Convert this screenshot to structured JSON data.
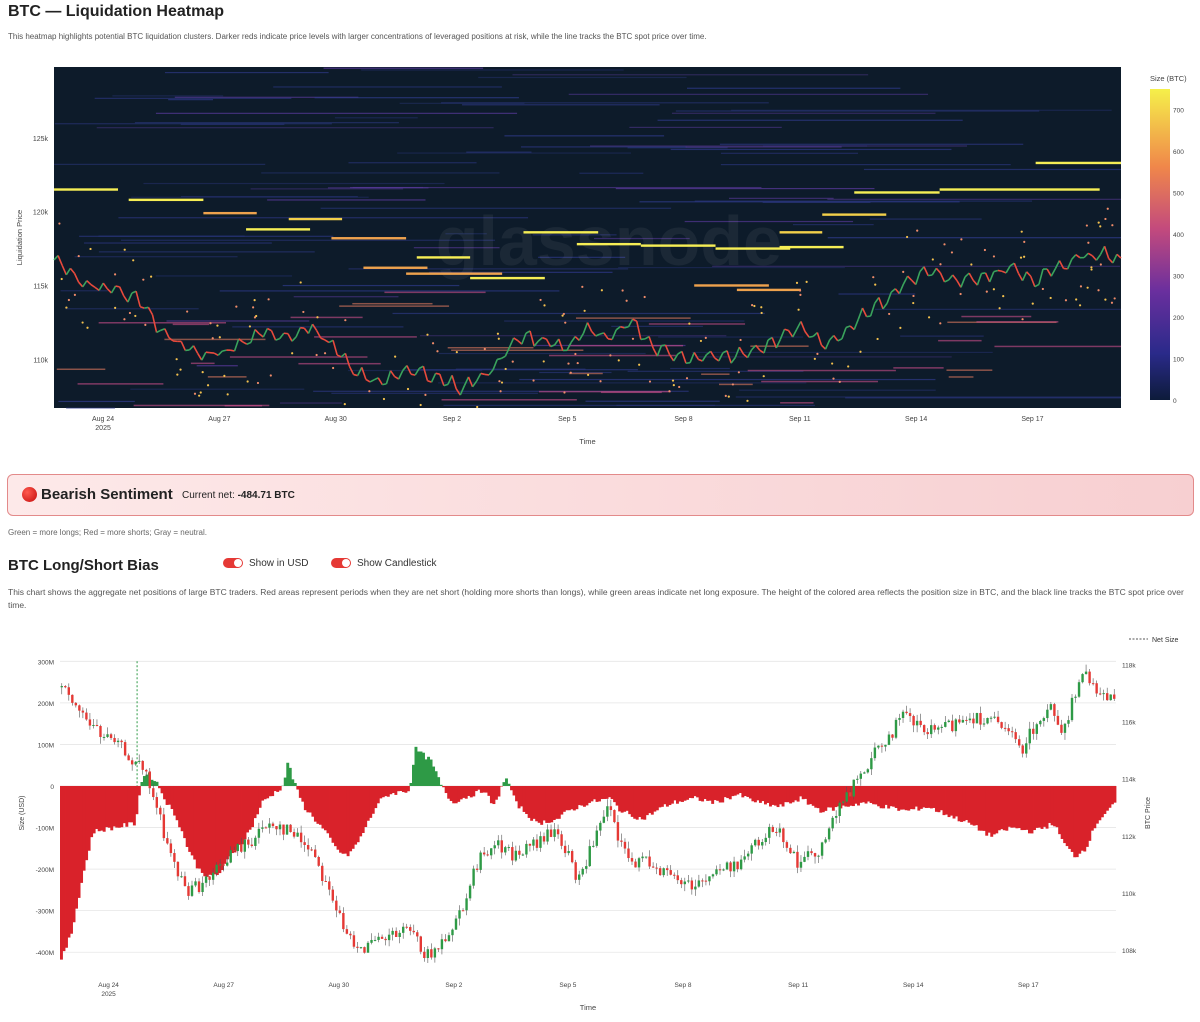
{
  "heatmap": {
    "title": "BTC — Liquidation Heatmap",
    "description": "This heatmap highlights potential BTC liquidation clusters. Darker reds indicate price levels with larger concentrations of leveraged positions at risk, while the line tracks the BTC spot price over time.",
    "watermark": "glassnode",
    "colors": {
      "background": "#0d1b2a",
      "low": "#3b3a9e",
      "mid": "#c94f8a",
      "high": "#f6e64a"
    }
  },
  "sentiment": {
    "label": "Bearish Sentiment",
    "net_label": "Current net:",
    "net_value": "-484.71 BTC",
    "color": "#d32f2f"
  },
  "legend_note": "Green = more longs; Red = more shorts; Gray = neutral.",
  "bias": {
    "title": "BTC Long/Short Bias",
    "toggle_usd": "Show in USD",
    "toggle_candles": "Show Candlestick",
    "description": "This chart shows the aggregate net positions of large BTC traders. Red areas represent periods when they are net short (holding more shorts than longs), while green areas indicate net long exposure. The height of the colored area reflects the position size in BTC, and the black line tracks the BTC spot price over time.",
    "colors": {
      "short": "#d9222a",
      "long": "#2e9a46",
      "candle_up": "#2e9a46",
      "candle_down": "#e53935"
    }
  },
  "chart_data": [
    {
      "type": "heatmap",
      "xlabel": "Time",
      "ylabel": "Liquidation Price",
      "x_ticks": [
        "Aug 24",
        "Aug 27",
        "Aug 30",
        "Sep 2",
        "Sep 5",
        "Sep 8",
        "Sep 11",
        "Sep 14",
        "Sep 17"
      ],
      "x_tick_sub": "2025",
      "y_ticks": [
        "125k",
        "120k",
        "115k",
        "110k"
      ],
      "ylim": [
        106700,
        129800
      ],
      "colorbar": {
        "label": "Size (BTC)",
        "ticks": [
          0,
          100,
          200,
          300,
          400,
          500,
          600,
          700
        ],
        "range": [
          0,
          750
        ]
      },
      "price_line": [
        [
          0,
          116800
        ],
        [
          0.02,
          115500
        ],
        [
          0.04,
          115000
        ],
        [
          0.06,
          114600
        ],
        [
          0.08,
          114100
        ],
        [
          0.1,
          112000
        ],
        [
          0.12,
          110800
        ],
        [
          0.14,
          110200
        ],
        [
          0.16,
          110500
        ],
        [
          0.18,
          111200
        ],
        [
          0.2,
          111800
        ],
        [
          0.22,
          111600
        ],
        [
          0.24,
          112200
        ],
        [
          0.26,
          111000
        ],
        [
          0.28,
          109200
        ],
        [
          0.3,
          108500
        ],
        [
          0.32,
          108900
        ],
        [
          0.34,
          109200
        ],
        [
          0.36,
          108800
        ],
        [
          0.38,
          108100
        ],
        [
          0.4,
          108700
        ],
        [
          0.42,
          110200
        ],
        [
          0.44,
          111600
        ],
        [
          0.46,
          111200
        ],
        [
          0.48,
          110800
        ],
        [
          0.5,
          112000
        ],
        [
          0.52,
          111200
        ],
        [
          0.54,
          112800
        ],
        [
          0.56,
          111000
        ],
        [
          0.58,
          110300
        ],
        [
          0.6,
          110100
        ],
        [
          0.62,
          110300
        ],
        [
          0.64,
          110200
        ],
        [
          0.66,
          110700
        ],
        [
          0.68,
          111300
        ],
        [
          0.7,
          112400
        ],
        [
          0.72,
          111000
        ],
        [
          0.74,
          111800
        ],
        [
          0.76,
          113200
        ],
        [
          0.78,
          114000
        ],
        [
          0.8,
          115300
        ],
        [
          0.82,
          116000
        ],
        [
          0.84,
          115200
        ],
        [
          0.86,
          115400
        ],
        [
          0.88,
          115800
        ],
        [
          0.9,
          116200
        ],
        [
          0.92,
          115300
        ],
        [
          0.94,
          116300
        ],
        [
          0.96,
          116900
        ],
        [
          0.98,
          117300
        ],
        [
          1.0,
          116800
        ]
      ],
      "clusters": [
        {
          "x0": 0.0,
          "x1": 0.06,
          "y": 121500,
          "size": 720
        },
        {
          "x0": 0.07,
          "x1": 0.14,
          "y": 120800,
          "size": 700
        },
        {
          "x0": 0.14,
          "x1": 0.19,
          "y": 119900,
          "size": 640
        },
        {
          "x0": 0.18,
          "x1": 0.24,
          "y": 118800,
          "size": 700
        },
        {
          "x0": 0.22,
          "x1": 0.27,
          "y": 119500,
          "size": 660
        },
        {
          "x0": 0.26,
          "x1": 0.33,
          "y": 118200,
          "size": 600
        },
        {
          "x0": 0.29,
          "x1": 0.35,
          "y": 116200,
          "size": 620
        },
        {
          "x0": 0.33,
          "x1": 0.42,
          "y": 115800,
          "size": 640
        },
        {
          "x0": 0.34,
          "x1": 0.39,
          "y": 116900,
          "size": 700
        },
        {
          "x0": 0.39,
          "x1": 0.46,
          "y": 115500,
          "size": 700
        },
        {
          "x0": 0.44,
          "x1": 0.51,
          "y": 118600,
          "size": 720
        },
        {
          "x0": 0.49,
          "x1": 0.55,
          "y": 117800,
          "size": 700
        },
        {
          "x0": 0.55,
          "x1": 0.62,
          "y": 117700,
          "size": 720
        },
        {
          "x0": 0.62,
          "x1": 0.69,
          "y": 117500,
          "size": 700
        },
        {
          "x0": 0.68,
          "x1": 0.74,
          "y": 117600,
          "size": 700
        },
        {
          "x0": 0.6,
          "x1": 0.67,
          "y": 115000,
          "size": 620
        },
        {
          "x0": 0.64,
          "x1": 0.7,
          "y": 114700,
          "size": 640
        },
        {
          "x0": 0.68,
          "x1": 0.72,
          "y": 118600,
          "size": 660
        },
        {
          "x0": 0.72,
          "x1": 0.78,
          "y": 119800,
          "size": 660
        },
        {
          "x0": 0.75,
          "x1": 0.83,
          "y": 121300,
          "size": 720
        },
        {
          "x0": 0.83,
          "x1": 0.98,
          "y": 121500,
          "size": 740
        },
        {
          "x0": 0.92,
          "x1": 1.0,
          "y": 123300,
          "size": 700
        }
      ]
    },
    {
      "type": "area",
      "xlabel": "Time",
      "ylabel": "Size (USD)",
      "y2label": "BTC Price",
      "legend": "Net Size",
      "legend_position": "top-right",
      "x_ticks": [
        "Aug 24",
        "Aug 27",
        "Aug 30",
        "Sep 2",
        "Sep 5",
        "Sep 8",
        "Sep 11",
        "Sep 14",
        "Sep 17"
      ],
      "x_tick_sub": "2025",
      "y_ticks": [
        "300M",
        "200M",
        "100M",
        "0",
        "-100M",
        "-200M",
        "-300M",
        "-400M"
      ],
      "y2_ticks": [
        "118k",
        "116k",
        "114k",
        "112k",
        "110k",
        "108k"
      ],
      "ylim": [
        -450,
        320
      ],
      "y2lim": [
        107200,
        118400
      ],
      "net_size": [
        [
          0,
          -420
        ],
        [
          0.01,
          -350
        ],
        [
          0.02,
          -220
        ],
        [
          0.03,
          -110
        ],
        [
          0.05,
          -100
        ],
        [
          0.07,
          -90
        ],
        [
          0.075,
          0
        ],
        [
          0.08,
          35
        ],
        [
          0.09,
          10
        ],
        [
          0.1,
          -40
        ],
        [
          0.11,
          -80
        ],
        [
          0.12,
          -150
        ],
        [
          0.13,
          -200
        ],
        [
          0.14,
          -220
        ],
        [
          0.15,
          -210
        ],
        [
          0.16,
          -170
        ],
        [
          0.17,
          -140
        ],
        [
          0.18,
          -100
        ],
        [
          0.19,
          -40
        ],
        [
          0.2,
          -20
        ],
        [
          0.21,
          0
        ],
        [
          0.215,
          60
        ],
        [
          0.22,
          10
        ],
        [
          0.23,
          -50
        ],
        [
          0.24,
          -80
        ],
        [
          0.25,
          -110
        ],
        [
          0.26,
          -150
        ],
        [
          0.27,
          -170
        ],
        [
          0.28,
          -140
        ],
        [
          0.29,
          -90
        ],
        [
          0.3,
          -40
        ],
        [
          0.31,
          -20
        ],
        [
          0.33,
          -10
        ],
        [
          0.335,
          90
        ],
        [
          0.34,
          80
        ],
        [
          0.35,
          60
        ],
        [
          0.36,
          0
        ],
        [
          0.37,
          -40
        ],
        [
          0.38,
          -30
        ],
        [
          0.39,
          -20
        ],
        [
          0.4,
          -10
        ],
        [
          0.41,
          -50
        ],
        [
          0.42,
          20
        ],
        [
          0.425,
          0
        ],
        [
          0.43,
          -40
        ],
        [
          0.45,
          -90
        ],
        [
          0.47,
          -80
        ],
        [
          0.48,
          -60
        ],
        [
          0.5,
          -40
        ],
        [
          0.52,
          -30
        ],
        [
          0.53,
          -60
        ],
        [
          0.55,
          -80
        ],
        [
          0.57,
          -50
        ],
        [
          0.58,
          -40
        ],
        [
          0.6,
          -30
        ],
        [
          0.62,
          -40
        ],
        [
          0.64,
          -20
        ],
        [
          0.66,
          -40
        ],
        [
          0.68,
          -50
        ],
        [
          0.7,
          -30
        ],
        [
          0.72,
          -60
        ],
        [
          0.74,
          -50
        ],
        [
          0.76,
          -40
        ],
        [
          0.78,
          -50
        ],
        [
          0.8,
          -60
        ],
        [
          0.82,
          -50
        ],
        [
          0.84,
          -70
        ],
        [
          0.86,
          -90
        ],
        [
          0.88,
          -120
        ],
        [
          0.9,
          -100
        ],
        [
          0.92,
          -110
        ],
        [
          0.94,
          -90
        ],
        [
          0.95,
          -140
        ],
        [
          0.96,
          -170
        ],
        [
          0.97,
          -150
        ],
        [
          0.98,
          -90
        ],
        [
          0.99,
          -60
        ],
        [
          1.0,
          -40
        ]
      ],
      "btc_price": [
        [
          0,
          117200
        ],
        [
          0.02,
          116300
        ],
        [
          0.04,
          115500
        ],
        [
          0.06,
          115000
        ],
        [
          0.08,
          114200
        ],
        [
          0.09,
          113200
        ],
        [
          0.1,
          111900
        ],
        [
          0.11,
          110800
        ],
        [
          0.12,
          110100
        ],
        [
          0.14,
          110400
        ],
        [
          0.16,
          111300
        ],
        [
          0.18,
          111800
        ],
        [
          0.2,
          112500
        ],
        [
          0.22,
          112100
        ],
        [
          0.24,
          111500
        ],
        [
          0.25,
          110500
        ],
        [
          0.26,
          109700
        ],
        [
          0.27,
          108500
        ],
        [
          0.29,
          108100
        ],
        [
          0.31,
          108400
        ],
        [
          0.33,
          108700
        ],
        [
          0.34,
          108200
        ],
        [
          0.35,
          107700
        ],
        [
          0.36,
          108200
        ],
        [
          0.38,
          109400
        ],
        [
          0.39,
          110600
        ],
        [
          0.4,
          111300
        ],
        [
          0.41,
          111800
        ],
        [
          0.43,
          111300
        ],
        [
          0.45,
          111700
        ],
        [
          0.47,
          112200
        ],
        [
          0.48,
          111400
        ],
        [
          0.49,
          110400
        ],
        [
          0.5,
          111300
        ],
        [
          0.52,
          113000
        ],
        [
          0.53,
          111700
        ],
        [
          0.54,
          111100
        ],
        [
          0.56,
          111100
        ],
        [
          0.58,
          110500
        ],
        [
          0.6,
          110300
        ],
        [
          0.62,
          110700
        ],
        [
          0.64,
          111000
        ],
        [
          0.66,
          111700
        ],
        [
          0.68,
          112400
        ],
        [
          0.69,
          111600
        ],
        [
          0.7,
          111000
        ],
        [
          0.72,
          111600
        ],
        [
          0.74,
          113100
        ],
        [
          0.76,
          114200
        ],
        [
          0.78,
          115300
        ],
        [
          0.8,
          116200
        ],
        [
          0.82,
          115600
        ],
        [
          0.84,
          115800
        ],
        [
          0.86,
          116200
        ],
        [
          0.88,
          116100
        ],
        [
          0.9,
          115500
        ],
        [
          0.91,
          115000
        ],
        [
          0.92,
          115700
        ],
        [
          0.94,
          116500
        ],
        [
          0.95,
          115600
        ],
        [
          0.96,
          116900
        ],
        [
          0.97,
          117600
        ],
        [
          0.98,
          117200
        ],
        [
          1.0,
          116800
        ]
      ]
    }
  ]
}
